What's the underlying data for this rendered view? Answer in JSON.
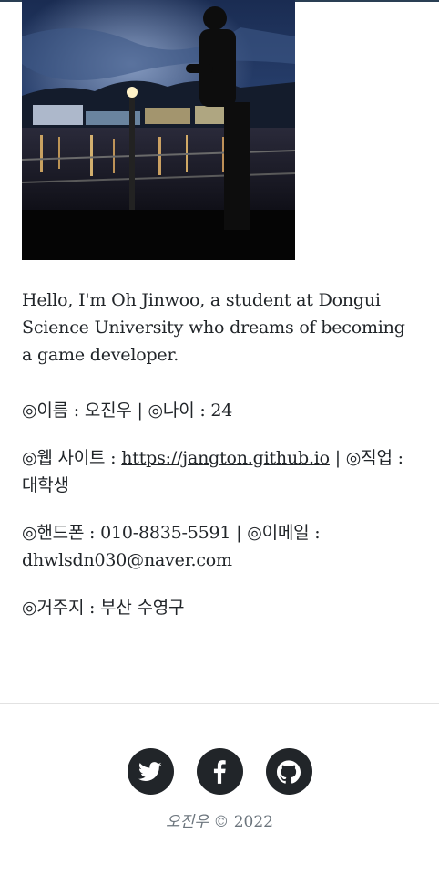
{
  "profile": {
    "photo_alt": "Profile photo",
    "intro": "Hello, I'm Oh Jinwoo, a student at Dongui Science University who dreams of becoming a game developer.",
    "line1_name": "◎이름 : 오진우 | ◎나이 : 24",
    "line2_prefix": "◎웹 사이트 : ",
    "website": "https://jangton.github.io",
    "line2_suffix": " | ◎직업 : 대학생",
    "line3": "◎핸드폰 : 010-8835-5591 | ◎이메일 : dhwlsdn030@naver.com",
    "line4": "◎거주지 : 부산 수영구"
  },
  "footer": {
    "social": [
      {
        "name": "twitter-icon"
      },
      {
        "name": "facebook-icon"
      },
      {
        "name": "github-icon"
      }
    ],
    "author": "오진우",
    "copyright": " © 2022"
  },
  "colors": {
    "text": "#212529",
    "icon_bg": "#212529",
    "muted": "#6c757d"
  }
}
